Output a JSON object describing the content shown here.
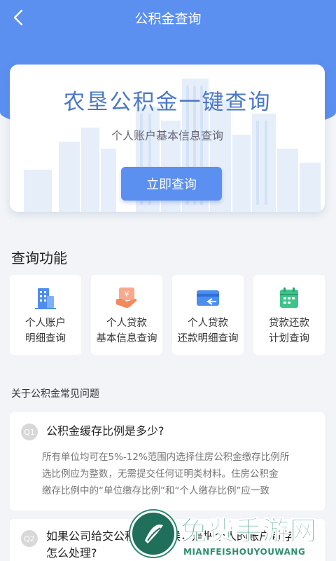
{
  "header": {
    "title": "公积金查询",
    "back_icon": "back-chevron-icon"
  },
  "hero": {
    "title": "农垦公积金一键查询",
    "subtitle": "个人账户基本信息查询",
    "button_label": "立即查询"
  },
  "functions": {
    "title": "查询功能",
    "items": [
      {
        "icon": "building-icon",
        "line1": "个人账户",
        "line2": "明细查询"
      },
      {
        "icon": "yuan-loan-icon",
        "line1": "个人贷款",
        "line2": "基本信息查询"
      },
      {
        "icon": "card-repay-icon",
        "line1": "个人贷款",
        "line2": "还款明细查询"
      },
      {
        "icon": "calendar-icon",
        "line1": "贷款还款",
        "line2": "计划查询"
      }
    ]
  },
  "faq": {
    "heading": "关于公积金常见问题",
    "items": [
      {
        "badge": "Q1",
        "question": "公积金缓存比例是多少?",
        "answer_lines": [
          "所有单位均可在5%-12%范围内选择住房公积金缴存比例所",
          "选比例应为整数，无需提交任何证明类材料。住房公积金",
          "缴存比例中的“单位缴存比例”和“个人缴存比例”应一致"
        ]
      },
      {
        "badge": "Q2",
        "question_lines": [
          "如果公司给交公积金的时候，是把个人的账户封存",
          "怎么处理?"
        ]
      }
    ]
  },
  "watermark": {
    "title": "免费手游网",
    "subtitle": "MIANFEISHOUYOUWANG"
  },
  "colors": {
    "primary": "#5b8ff0",
    "hero_title": "#4a78c8",
    "watermark": "#2f8f6f"
  }
}
